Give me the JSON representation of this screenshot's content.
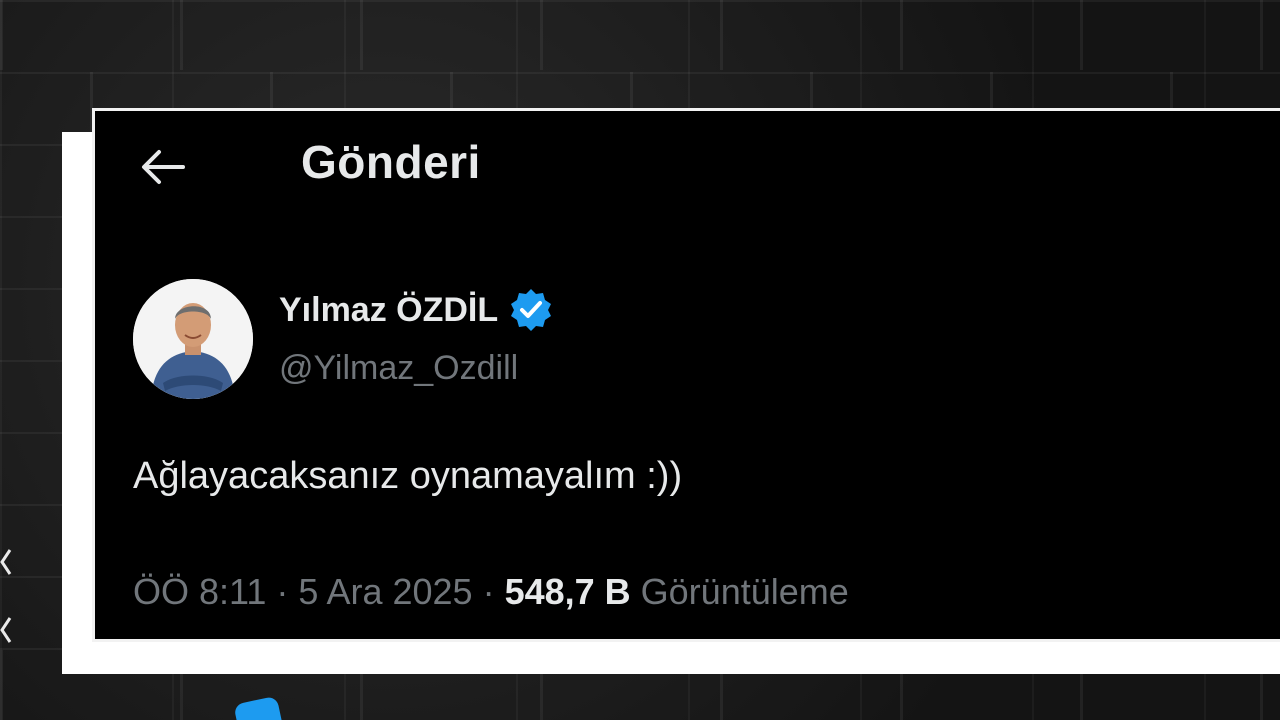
{
  "header": {
    "title": "Gönderi",
    "back_icon": "arrow-left-icon"
  },
  "author": {
    "display_name": "Yılmaz ÖZDİL",
    "handle": "@Yilmaz_Ozdill",
    "verified": true,
    "verified_icon": "verified-badge-icon",
    "verified_color": "#1d9bf0"
  },
  "tweet": {
    "text": "Ağlayacaksanız oynamayalım :))"
  },
  "meta": {
    "time": "ÖÖ 8:11",
    "separator_1": " · ",
    "date": "5 Ara 2025",
    "separator_2": " · ",
    "views_count": "548,7 B",
    "views_label": " Görüntüleme"
  },
  "colors": {
    "background": "#000000",
    "primary_text": "#e7e9ea",
    "secondary_text": "#71767b",
    "accent": "#1d9bf0"
  }
}
